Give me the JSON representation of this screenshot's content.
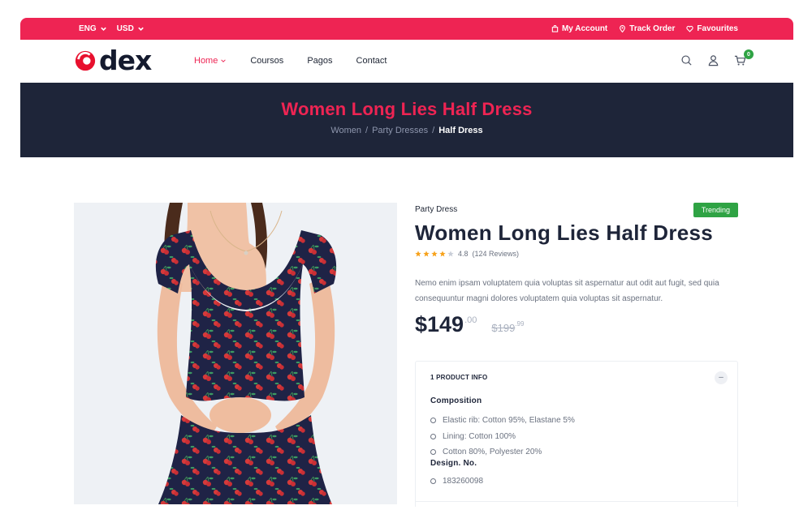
{
  "topbar": {
    "language": "ENG",
    "currency": "USD",
    "my_account": "My Account",
    "track_order": "Track Order",
    "favourites": "Favourites"
  },
  "brand": {
    "name": "dex",
    "accent": "#ee2453",
    "dark": "#1e2539"
  },
  "nav": {
    "items": [
      {
        "label": "Home",
        "active": true
      },
      {
        "label": "Coursos",
        "active": false
      },
      {
        "label": "Pagos",
        "active": false
      },
      {
        "label": "Contact",
        "active": false
      }
    ],
    "cart_count": "0"
  },
  "hero": {
    "title": "Women Long Lies Half Dress",
    "breadcrumb": [
      "Women",
      "Party Dresses",
      "Half Dress"
    ]
  },
  "product": {
    "category": "Party Dress",
    "badge": "Trending",
    "title": "Women Long Lies Half Dress",
    "rating": "4.8",
    "rating_stars": 4,
    "reviews": "(124 Reviews)",
    "description": "Nemo enim ipsam voluptatem quia voluptas sit aspernatur aut odit aut fugit, sed quia consequuntur magni dolores voluptatem quia voluptas sit aspernatur.",
    "price_main": "$149",
    "price_cents": ".00",
    "old_price_main": "$199",
    "old_price_cents": ".99"
  },
  "accordion": {
    "number": "1",
    "title": "PRODUCT INFO",
    "toggle": "–",
    "composition_title": "Composition",
    "composition": [
      "Elastic rib: Cotton 95%, Elastane 5%",
      "Lining: Cotton 100%",
      "Cotton 80%, Polyester 20%"
    ],
    "design_title": "Design. No.",
    "design_no": "183260098"
  }
}
